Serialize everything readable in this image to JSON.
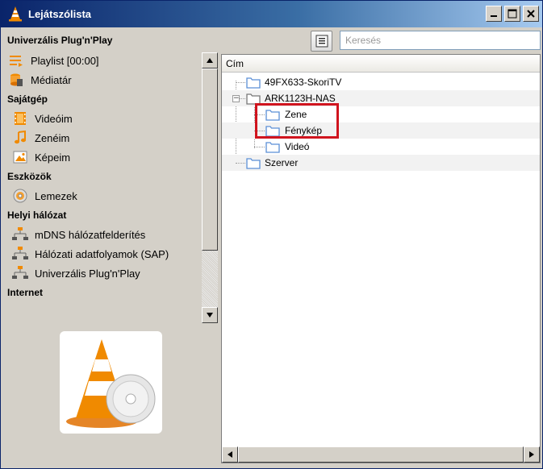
{
  "window": {
    "title": "Lejátszólista"
  },
  "sidebar": {
    "sections": [
      {
        "title": "Univerzális Plug'n'Play",
        "items": [
          {
            "label": "Playlist [00:00]",
            "icon": "playlist-icon"
          },
          {
            "label": "Médiatár",
            "icon": "media-library-icon"
          }
        ]
      },
      {
        "title": "Sajátgép",
        "items": [
          {
            "label": "Videóim",
            "icon": "film-icon"
          },
          {
            "label": "Zenéim",
            "icon": "music-note-icon"
          },
          {
            "label": "Képeim",
            "icon": "picture-icon"
          }
        ]
      },
      {
        "title": "Eszközök",
        "items": [
          {
            "label": "Lemezek",
            "icon": "disc-icon"
          }
        ]
      },
      {
        "title": "Helyi hálózat",
        "items": [
          {
            "label": "mDNS hálózatfelderítés",
            "icon": "network-icon"
          },
          {
            "label": "Hálózati adatfolyamok (SAP)",
            "icon": "network-icon"
          },
          {
            "label": "Univerzális Plug'n'Play",
            "icon": "network-icon"
          }
        ]
      },
      {
        "title": "Internet",
        "items": []
      }
    ]
  },
  "search": {
    "placeholder": "Keresés"
  },
  "tree": {
    "column_header": "Cím",
    "rows": [
      {
        "label": "49FX633-SkoriTV",
        "level": 0,
        "expanded": null
      },
      {
        "label": "ARK1123H-NAS",
        "level": 0,
        "expanded": true
      },
      {
        "label": "Zene",
        "level": 1
      },
      {
        "label": "Fénykép",
        "level": 1
      },
      {
        "label": "Videó",
        "level": 1
      },
      {
        "label": "Szerver",
        "level": 0
      }
    ]
  },
  "colors": {
    "highlight": "#d0141e",
    "titlebar": "#0a246a",
    "folder": "#5b8fd6"
  }
}
